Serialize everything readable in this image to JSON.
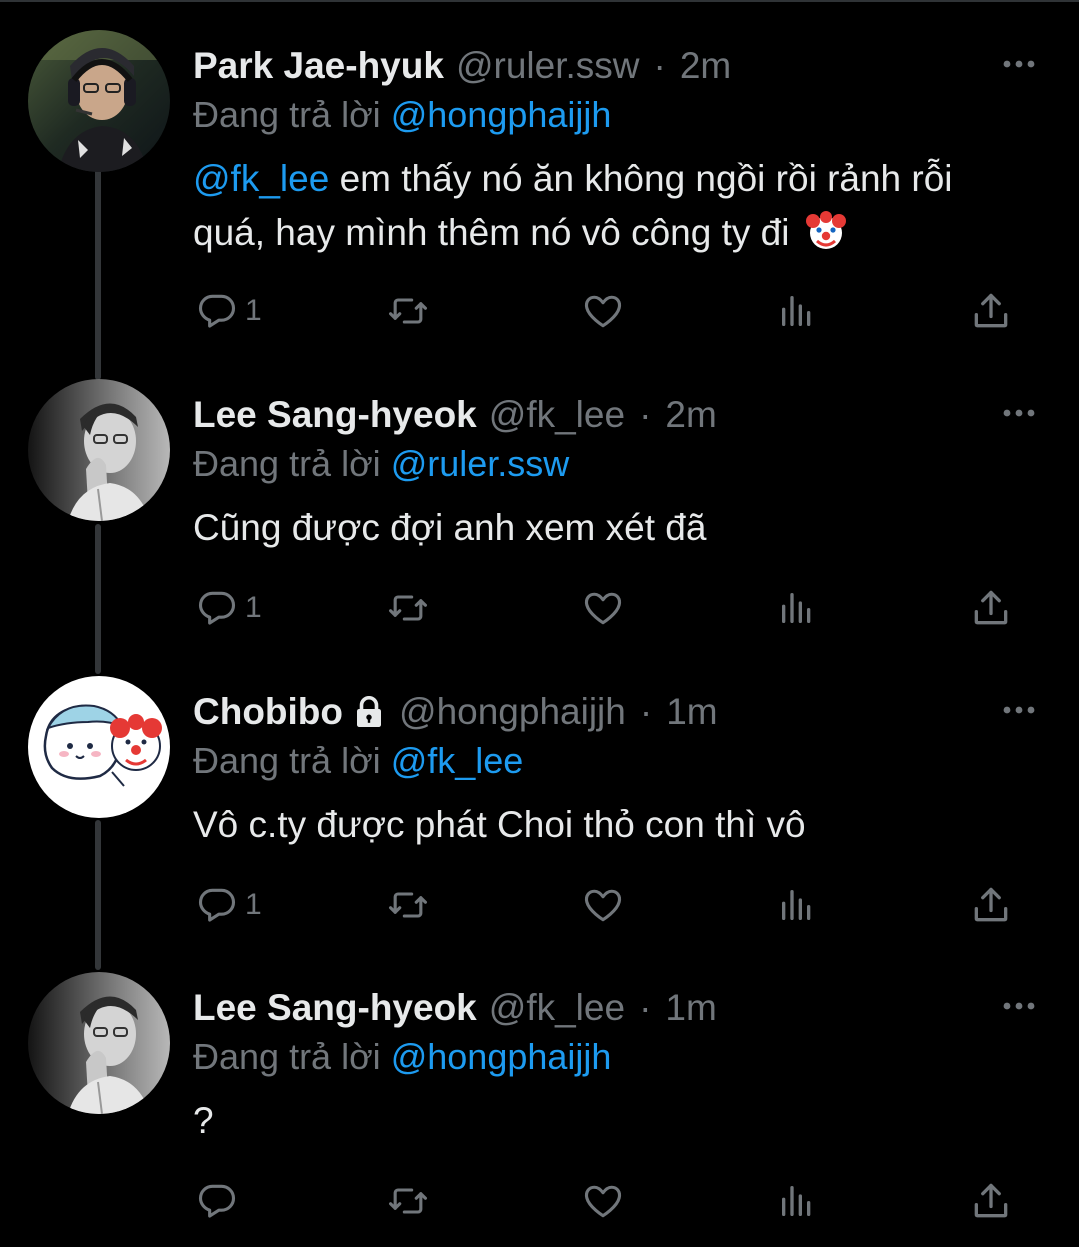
{
  "colors": {
    "background": "#000000",
    "text": "#e7e9ea",
    "secondary": "#71767b",
    "mention": "#1d9bf0",
    "thread_line": "#333639"
  },
  "reply_prefix": "Đang trả lời",
  "tweets": [
    {
      "name": "Park Jae-hyuk",
      "handle": "@ruler.ssw",
      "dot": "·",
      "time": "2m",
      "replying_to": "@hongphaijjh",
      "body_mention": "@fk_lee",
      "body_text": " em thấy nó ăn không ngồi rồi rảnh rỗi quá, hay mình thêm nó vô công ty đi",
      "body_emoji": "clown-face-emoji",
      "replies": "1",
      "avatar": "avatar-player-headset",
      "locked": false
    },
    {
      "name": "Lee Sang-hyeok",
      "handle": "@fk_lee",
      "dot": "·",
      "time": "2m",
      "replying_to": "@ruler.ssw",
      "body_text": "Cũng được đợi anh xem xét đã",
      "replies": "1",
      "avatar": "avatar-grayscale-portrait",
      "locked": false
    },
    {
      "name": "Chobibo",
      "handle": "@hongphaijjh",
      "dot": "·",
      "time": "1m",
      "replying_to": "@fk_lee",
      "body_text": "Vô c.ty được phát Choi thỏ con thì vô",
      "replies": "1",
      "avatar": "avatar-cartoon-clown",
      "locked": true
    },
    {
      "name": "Lee Sang-hyeok",
      "handle": "@fk_lee",
      "dot": "·",
      "time": "1m",
      "replying_to": "@hongphaijjh",
      "body_text": "?",
      "replies": "",
      "avatar": "avatar-grayscale-portrait",
      "locked": false
    }
  ]
}
